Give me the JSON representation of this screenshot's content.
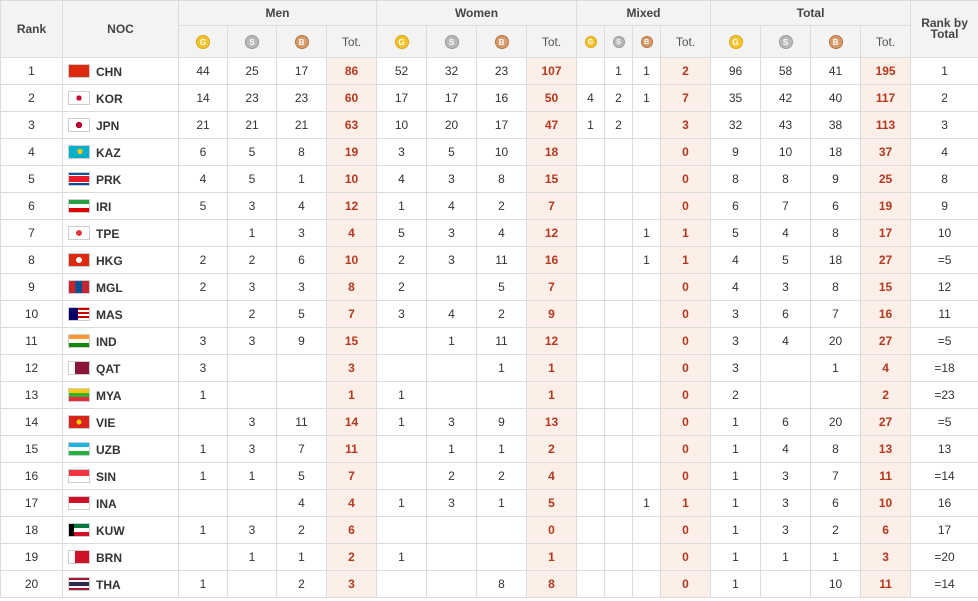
{
  "headers": {
    "rank": "Rank",
    "noc": "NOC",
    "men": "Men",
    "women": "Women",
    "mixed": "Mixed",
    "total": "Total",
    "rank_by_total": "Rank by Total",
    "tot": "Tot.",
    "gold_letter": "G",
    "silver_letter": "S",
    "bronze_letter": "B"
  },
  "colors": {
    "gold": "#f2c431",
    "silver": "#b9b9b9",
    "bronze": "#d79a6a",
    "total_text": "#b3381f",
    "total_bg": "#fcefe8"
  },
  "rows": [
    {
      "rank": "1",
      "noc": "CHN",
      "flag": "china-flag",
      "m": [
        "44",
        "25",
        "17",
        "86"
      ],
      "w": [
        "52",
        "32",
        "23",
        "107"
      ],
      "x": [
        "",
        "1",
        "1",
        "2"
      ],
      "t": [
        "96",
        "58",
        "41",
        "195"
      ],
      "rbt": "1"
    },
    {
      "rank": "2",
      "noc": "KOR",
      "flag": "korea-flag",
      "m": [
        "14",
        "23",
        "23",
        "60"
      ],
      "w": [
        "17",
        "17",
        "16",
        "50"
      ],
      "x": [
        "4",
        "2",
        "1",
        "7"
      ],
      "t": [
        "35",
        "42",
        "40",
        "117"
      ],
      "rbt": "2"
    },
    {
      "rank": "3",
      "noc": "JPN",
      "flag": "japan-flag",
      "m": [
        "21",
        "21",
        "21",
        "63"
      ],
      "w": [
        "10",
        "20",
        "17",
        "47"
      ],
      "x": [
        "1",
        "2",
        "",
        "3"
      ],
      "t": [
        "32",
        "43",
        "38",
        "113"
      ],
      "rbt": "3"
    },
    {
      "rank": "4",
      "noc": "KAZ",
      "flag": "kazakhstan-flag",
      "m": [
        "6",
        "5",
        "8",
        "19"
      ],
      "w": [
        "3",
        "5",
        "10",
        "18"
      ],
      "x": [
        "",
        "",
        "",
        "0"
      ],
      "t": [
        "9",
        "10",
        "18",
        "37"
      ],
      "rbt": "4"
    },
    {
      "rank": "5",
      "noc": "PRK",
      "flag": "north-korea-flag",
      "m": [
        "4",
        "5",
        "1",
        "10"
      ],
      "w": [
        "4",
        "3",
        "8",
        "15"
      ],
      "x": [
        "",
        "",
        "",
        "0"
      ],
      "t": [
        "8",
        "8",
        "9",
        "25"
      ],
      "rbt": "8"
    },
    {
      "rank": "6",
      "noc": "IRI",
      "flag": "iran-flag",
      "m": [
        "5",
        "3",
        "4",
        "12"
      ],
      "w": [
        "1",
        "4",
        "2",
        "7"
      ],
      "x": [
        "",
        "",
        "",
        "0"
      ],
      "t": [
        "6",
        "7",
        "6",
        "19"
      ],
      "rbt": "9"
    },
    {
      "rank": "7",
      "noc": "TPE",
      "flag": "chinese-taipei-flag",
      "m": [
        "",
        "1",
        "3",
        "4"
      ],
      "w": [
        "5",
        "3",
        "4",
        "12"
      ],
      "x": [
        "",
        "",
        "1",
        "1"
      ],
      "t": [
        "5",
        "4",
        "8",
        "17"
      ],
      "rbt": "10"
    },
    {
      "rank": "8",
      "noc": "HKG",
      "flag": "hong-kong-flag",
      "m": [
        "2",
        "2",
        "6",
        "10"
      ],
      "w": [
        "2",
        "3",
        "11",
        "16"
      ],
      "x": [
        "",
        "",
        "1",
        "1"
      ],
      "t": [
        "4",
        "5",
        "18",
        "27"
      ],
      "rbt": "=5"
    },
    {
      "rank": "9",
      "noc": "MGL",
      "flag": "mongolia-flag",
      "m": [
        "2",
        "3",
        "3",
        "8"
      ],
      "w": [
        "2",
        "",
        "5",
        "7"
      ],
      "x": [
        "",
        "",
        "",
        "0"
      ],
      "t": [
        "4",
        "3",
        "8",
        "15"
      ],
      "rbt": "12"
    },
    {
      "rank": "10",
      "noc": "MAS",
      "flag": "malaysia-flag",
      "m": [
        "",
        "2",
        "5",
        "7"
      ],
      "w": [
        "3",
        "4",
        "2",
        "9"
      ],
      "x": [
        "",
        "",
        "",
        "0"
      ],
      "t": [
        "3",
        "6",
        "7",
        "16"
      ],
      "rbt": "11"
    },
    {
      "rank": "11",
      "noc": "IND",
      "flag": "india-flag",
      "m": [
        "3",
        "3",
        "9",
        "15"
      ],
      "w": [
        "",
        "1",
        "11",
        "12"
      ],
      "x": [
        "",
        "",
        "",
        "0"
      ],
      "t": [
        "3",
        "4",
        "20",
        "27"
      ],
      "rbt": "=5"
    },
    {
      "rank": "12",
      "noc": "QAT",
      "flag": "qatar-flag",
      "m": [
        "3",
        "",
        "",
        "3"
      ],
      "w": [
        "",
        "",
        "1",
        "1"
      ],
      "x": [
        "",
        "",
        "",
        "0"
      ],
      "t": [
        "3",
        "",
        "1",
        "4"
      ],
      "rbt": "=18"
    },
    {
      "rank": "13",
      "noc": "MYA",
      "flag": "myanmar-flag",
      "m": [
        "1",
        "",
        "",
        "1"
      ],
      "w": [
        "1",
        "",
        "",
        "1"
      ],
      "x": [
        "",
        "",
        "",
        "0"
      ],
      "t": [
        "2",
        "",
        "",
        "2"
      ],
      "rbt": "=23"
    },
    {
      "rank": "14",
      "noc": "VIE",
      "flag": "vietnam-flag",
      "m": [
        "",
        "3",
        "11",
        "14"
      ],
      "w": [
        "1",
        "3",
        "9",
        "13"
      ],
      "x": [
        "",
        "",
        "",
        "0"
      ],
      "t": [
        "1",
        "6",
        "20",
        "27"
      ],
      "rbt": "=5"
    },
    {
      "rank": "15",
      "noc": "UZB",
      "flag": "uzbekistan-flag",
      "m": [
        "1",
        "3",
        "7",
        "11"
      ],
      "w": [
        "",
        "1",
        "1",
        "2"
      ],
      "x": [
        "",
        "",
        "",
        "0"
      ],
      "t": [
        "1",
        "4",
        "8",
        "13"
      ],
      "rbt": "13"
    },
    {
      "rank": "16",
      "noc": "SIN",
      "flag": "singapore-flag",
      "m": [
        "1",
        "1",
        "5",
        "7"
      ],
      "w": [
        "",
        "2",
        "2",
        "4"
      ],
      "x": [
        "",
        "",
        "",
        "0"
      ],
      "t": [
        "1",
        "3",
        "7",
        "11"
      ],
      "rbt": "=14"
    },
    {
      "rank": "17",
      "noc": "INA",
      "flag": "indonesia-flag",
      "m": [
        "",
        "",
        "4",
        "4"
      ],
      "w": [
        "1",
        "3",
        "1",
        "5"
      ],
      "x": [
        "",
        "",
        "1",
        "1"
      ],
      "t": [
        "1",
        "3",
        "6",
        "10"
      ],
      "rbt": "16"
    },
    {
      "rank": "18",
      "noc": "KUW",
      "flag": "kuwait-flag",
      "m": [
        "1",
        "3",
        "2",
        "6"
      ],
      "w": [
        "",
        "",
        "",
        "0"
      ],
      "x": [
        "",
        "",
        "",
        "0"
      ],
      "t": [
        "1",
        "3",
        "2",
        "6"
      ],
      "rbt": "17"
    },
    {
      "rank": "19",
      "noc": "BRN",
      "flag": "bahrain-flag",
      "m": [
        "",
        "1",
        "1",
        "2"
      ],
      "w": [
        "1",
        "",
        "",
        "1"
      ],
      "x": [
        "",
        "",
        "",
        "0"
      ],
      "t": [
        "1",
        "1",
        "1",
        "3"
      ],
      "rbt": "=20"
    },
    {
      "rank": "20",
      "noc": "THA",
      "flag": "thailand-flag",
      "m": [
        "1",
        "",
        "2",
        "3"
      ],
      "w": [
        "",
        "",
        "8",
        "8"
      ],
      "x": [
        "",
        "",
        "",
        "0"
      ],
      "t": [
        "1",
        "",
        "10",
        "11"
      ],
      "rbt": "=14"
    }
  ]
}
